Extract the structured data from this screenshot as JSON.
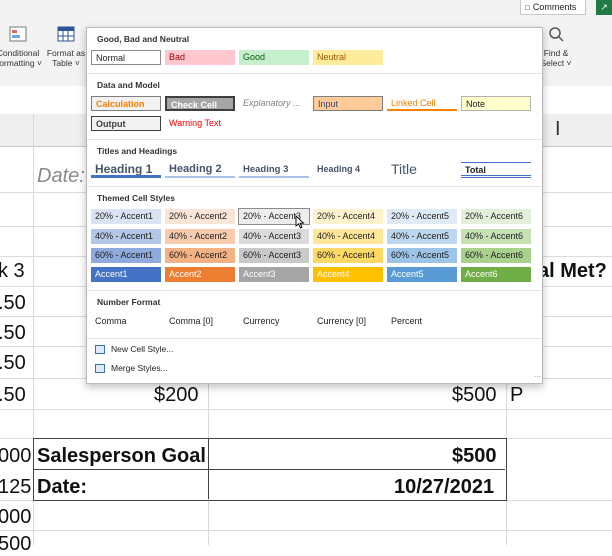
{
  "ribbon": {
    "comments_label": "Comments",
    "share_label": "↗",
    "conditional_formatting": [
      "Conditional",
      "Formatting ˅"
    ],
    "format_as_table": [
      "Format as",
      "Table ˅"
    ],
    "find_select": [
      "Find &",
      "Select ˅"
    ]
  },
  "sheet": {
    "column_header_I": "I",
    "date_label_italic": "Date:",
    "left_partial": [
      "k 3",
      ".50",
      ".50",
      ".50",
      ".50",
      "000",
      "125",
      "000",
      "500"
    ],
    "right_partial_header": "al Met?",
    "row_200": "$200",
    "row_500": "$500",
    "row_P": "P",
    "goal_label": "Salesperson Goal",
    "goal_value": "$500",
    "date_label": "Date:",
    "date_value": "10/27/2021"
  },
  "gallery": {
    "sections": {
      "good_bad": "Good, Bad and Neutral",
      "data_model": "Data and Model",
      "titles": "Titles and Headings",
      "themed": "Themed Cell Styles",
      "number": "Number Format"
    },
    "good_bad": [
      "Normal",
      "Bad",
      "Good",
      "Neutral"
    ],
    "data_model_row1": [
      "Calculation",
      "Check Cell",
      "Explanatory ...",
      "Input",
      "Linked Cell",
      "Note"
    ],
    "data_model_row2": [
      "Output",
      "Warning Text"
    ],
    "titles": [
      "Heading 1",
      "Heading 2",
      "Heading 3",
      "Heading 4",
      "Title",
      "Total"
    ],
    "themed_20": [
      "20% - Accent1",
      "20% - Accent2",
      "20% - Accent3",
      "20% - Accent4",
      "20% - Accent5",
      "20% - Accent6"
    ],
    "themed_40": [
      "40% - Accent1",
      "40% - Accent2",
      "40% - Accent3",
      "40% - Accent4",
      "40% - Accent5",
      "40% - Accent6"
    ],
    "themed_60": [
      "60% - Accent1",
      "60% - Accent2",
      "60% - Accent3",
      "60% - Accent4",
      "60% - Accent5",
      "60% - Accent6"
    ],
    "themed_100": [
      "Accent1",
      "Accent2",
      "Accent3",
      "Accent4",
      "Accent5",
      "Accent6"
    ],
    "number": [
      "Comma",
      "Comma [0]",
      "Currency",
      "Currency [0]",
      "Percent"
    ],
    "menu": {
      "new_style": "New Cell Style...",
      "merge_styles": "Merge Styles..."
    }
  },
  "colors": {
    "bad_bg": "#ffc7ce",
    "bad_fg": "#9c0006",
    "good_bg": "#c6efce",
    "good_fg": "#006100",
    "neutral_bg": "#ffeb9c",
    "neutral_fg": "#9c5700",
    "accent1": "#4472c4",
    "accent2": "#ed7d31",
    "accent3": "#a5a5a5",
    "accent4": "#ffc000",
    "accent5": "#5b9bd5",
    "accent6": "#70ad47"
  }
}
